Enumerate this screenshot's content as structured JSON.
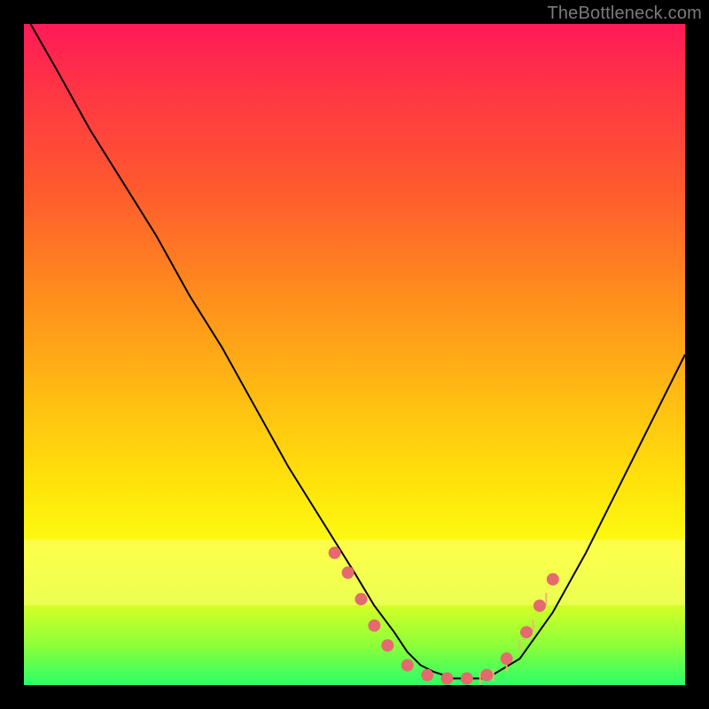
{
  "watermark": "TheBottleneck.com",
  "colors": {
    "frame": "#000000",
    "curve": "#000000",
    "dot": "#e46a6f",
    "tick": "#e9b86b"
  },
  "chart_data": {
    "type": "line",
    "title": "",
    "xlabel": "",
    "ylabel": "",
    "xlim": [
      0,
      100
    ],
    "ylim": [
      0,
      100
    ],
    "series": [
      {
        "name": "bottleneck-curve",
        "x": [
          1,
          5,
          10,
          15,
          20,
          25,
          30,
          35,
          40,
          45,
          50,
          53,
          56,
          58,
          60,
          62,
          65,
          70,
          75,
          80,
          85,
          90,
          95,
          100
        ],
        "y": [
          100,
          93,
          84,
          76,
          68,
          59,
          51,
          42,
          33,
          25,
          17,
          12,
          8,
          5,
          3,
          2,
          1,
          1,
          4,
          11,
          20,
          30,
          40,
          50
        ]
      }
    ],
    "highlight_band_y": [
      12,
      22
    ],
    "dots": [
      {
        "x": 47,
        "y": 20
      },
      {
        "x": 49,
        "y": 17
      },
      {
        "x": 51,
        "y": 13
      },
      {
        "x": 53,
        "y": 9
      },
      {
        "x": 55,
        "y": 6
      },
      {
        "x": 58,
        "y": 3
      },
      {
        "x": 61,
        "y": 1.5
      },
      {
        "x": 64,
        "y": 1
      },
      {
        "x": 67,
        "y": 1
      },
      {
        "x": 70,
        "y": 1.5
      },
      {
        "x": 73,
        "y": 4
      },
      {
        "x": 76,
        "y": 8
      },
      {
        "x": 78,
        "y": 12
      },
      {
        "x": 80,
        "y": 16
      }
    ],
    "ticks": [
      {
        "x": 69,
        "y": 1
      },
      {
        "x": 71,
        "y": 1.5
      },
      {
        "x": 73,
        "y": 3
      },
      {
        "x": 75,
        "y": 6
      },
      {
        "x": 77,
        "y": 9
      },
      {
        "x": 79,
        "y": 13
      }
    ]
  }
}
